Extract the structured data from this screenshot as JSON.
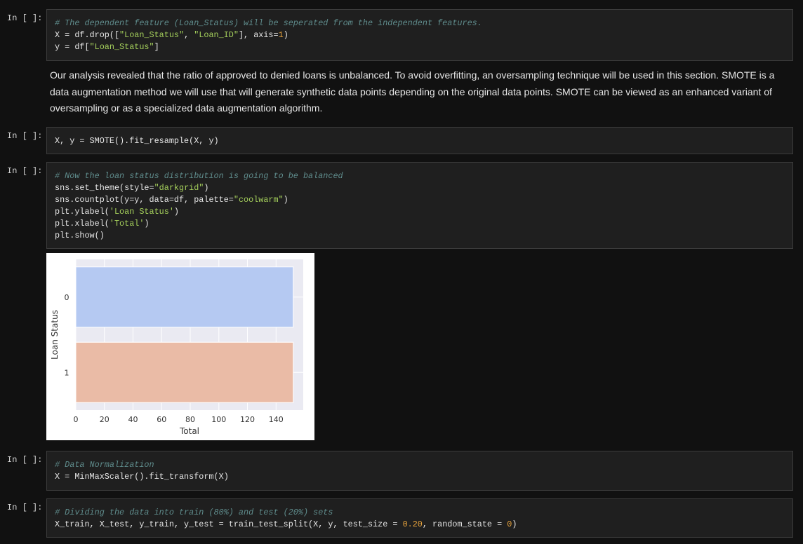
{
  "prompt_label": "In [ ]:",
  "cells": [
    {
      "lines": [
        [
          {
            "t": "# The dependent feature (Loan_Status) will be seperated from the independent features.",
            "c": "cm"
          }
        ],
        [
          {
            "t": "X = df.drop([",
            "c": ""
          },
          {
            "t": "\"Loan_Status\"",
            "c": "st"
          },
          {
            "t": ", ",
            "c": ""
          },
          {
            "t": "\"Loan_ID\"",
            "c": "st"
          },
          {
            "t": "], axis=",
            "c": ""
          },
          {
            "t": "1",
            "c": "nu"
          },
          {
            "t": ")",
            "c": ""
          }
        ],
        [
          {
            "t": "y = df[",
            "c": ""
          },
          {
            "t": "\"Loan_Status\"",
            "c": "st"
          },
          {
            "t": "]",
            "c": ""
          }
        ]
      ]
    },
    {
      "lines": [
        [
          {
            "t": "X, y = SMOTE().fit_resample(X, y)",
            "c": ""
          }
        ]
      ]
    },
    {
      "lines": [
        [
          {
            "t": "# Now the loan status distribution is going to be balanced",
            "c": "cm"
          }
        ],
        [
          {
            "t": "sns.set_theme(style=",
            "c": ""
          },
          {
            "t": "\"darkgrid\"",
            "c": "st"
          },
          {
            "t": ")",
            "c": ""
          }
        ],
        [
          {
            "t": "sns.countplot(y=y, data=df, palette=",
            "c": ""
          },
          {
            "t": "\"coolwarm\"",
            "c": "st"
          },
          {
            "t": ")",
            "c": ""
          }
        ],
        [
          {
            "t": "plt.ylabel(",
            "c": ""
          },
          {
            "t": "'Loan Status'",
            "c": "st"
          },
          {
            "t": ")",
            "c": ""
          }
        ],
        [
          {
            "t": "plt.xlabel(",
            "c": ""
          },
          {
            "t": "'Total'",
            "c": "st"
          },
          {
            "t": ")",
            "c": ""
          }
        ],
        [
          {
            "t": "plt.show()",
            "c": ""
          }
        ]
      ]
    },
    {
      "lines": [
        [
          {
            "t": "# Data Normalization",
            "c": "cm"
          }
        ],
        [
          {
            "t": "X = MinMaxScaler().fit_transform(X)",
            "c": ""
          }
        ]
      ]
    },
    {
      "lines": [
        [
          {
            "t": "# Dividing the data into train (80%) and test (20%) sets",
            "c": "cm"
          }
        ],
        [
          {
            "t": "X_train, X_test, y_train, y_test = train_test_split(X, y, test_size = ",
            "c": ""
          },
          {
            "t": "0.20",
            "c": "nu"
          },
          {
            "t": ", random_state = ",
            "c": ""
          },
          {
            "t": "0",
            "c": "nu"
          },
          {
            "t": ")",
            "c": ""
          }
        ]
      ]
    }
  ],
  "markdown": "Our analysis revealed that the ratio of approved to denied loans is unbalanced. To avoid overfitting, an oversampling technique will be used in this section. SMOTE is a data augmentation method we will use that will generate synthetic data points depending on the original data points. SMOTE can be viewed as an enhanced variant of oversampling or as a specialized data augmentation algorithm.",
  "chart_data": {
    "type": "bar",
    "orientation": "horizontal",
    "categories": [
      "0",
      "1"
    ],
    "values": [
      152,
      152
    ],
    "colors": [
      "#b5c9f2",
      "#eabba6"
    ],
    "xlabel": "Total",
    "ylabel": "Loan Status",
    "xticks": [
      "0",
      "20",
      "40",
      "60",
      "80",
      "100",
      "120",
      "140"
    ],
    "xlim": [
      0,
      159
    ],
    "grid": true,
    "style": "darkgrid"
  }
}
